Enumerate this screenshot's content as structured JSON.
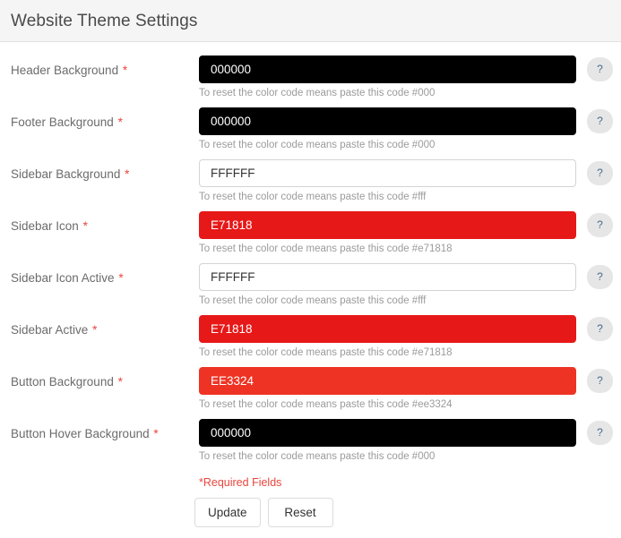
{
  "header": {
    "title": "Website Theme Settings"
  },
  "help_icon_label": "?",
  "fields": [
    {
      "label": "Header Background",
      "required_marker": "*",
      "value": "000000",
      "helper": "To reset the color code means paste this code #000",
      "swatch": "#000000",
      "text_color": "#ffffff",
      "style": "dark"
    },
    {
      "label": "Footer Background",
      "required_marker": "*",
      "value": "000000",
      "helper": "To reset the color code means paste this code #000",
      "swatch": "#000000",
      "text_color": "#ffffff",
      "style": "dark"
    },
    {
      "label": "Sidebar Background",
      "required_marker": "*",
      "value": "FFFFFF",
      "helper": "To reset the color code means paste this code #fff",
      "swatch": "#FFFFFF",
      "text_color": "#333333",
      "style": "light"
    },
    {
      "label": "Sidebar Icon",
      "required_marker": "*",
      "value": "E71818",
      "helper": "To reset the color code means paste this code #e71818",
      "swatch": "#E71818",
      "text_color": "#ffffff",
      "style": "color"
    },
    {
      "label": "Sidebar Icon Active",
      "required_marker": "*",
      "value": "FFFFFF",
      "helper": "To reset the color code means paste this code #fff",
      "swatch": "#FFFFFF",
      "text_color": "#333333",
      "style": "light"
    },
    {
      "label": "Sidebar Active",
      "required_marker": "*",
      "value": "E71818",
      "helper": "To reset the color code means paste this code #e71818",
      "swatch": "#E71818",
      "text_color": "#ffffff",
      "style": "color"
    },
    {
      "label": "Button Background",
      "required_marker": "*",
      "value": "EE3324",
      "helper": "To reset the color code means paste this code #ee3324",
      "swatch": "#EE3324",
      "text_color": "#ffffff",
      "style": "color"
    },
    {
      "label": "Button Hover Background",
      "required_marker": "*",
      "value": "000000",
      "helper": "To reset the color code means paste this code #000",
      "swatch": "#000000",
      "text_color": "#ffffff",
      "style": "dark"
    }
  ],
  "required_note": "*Required Fields",
  "actions": {
    "update_label": "Update",
    "reset_label": "Reset"
  },
  "colors": {
    "header_bg": "#f5f5f5",
    "header_border": "#e0e0e0",
    "label_text": "#6b6b6b",
    "helper_text": "#9b9b9b",
    "required_red": "#e8453c",
    "help_btn_bg": "#e6e6e6",
    "input_border": "#d4d4d4",
    "page_bg": "#ffffff"
  }
}
